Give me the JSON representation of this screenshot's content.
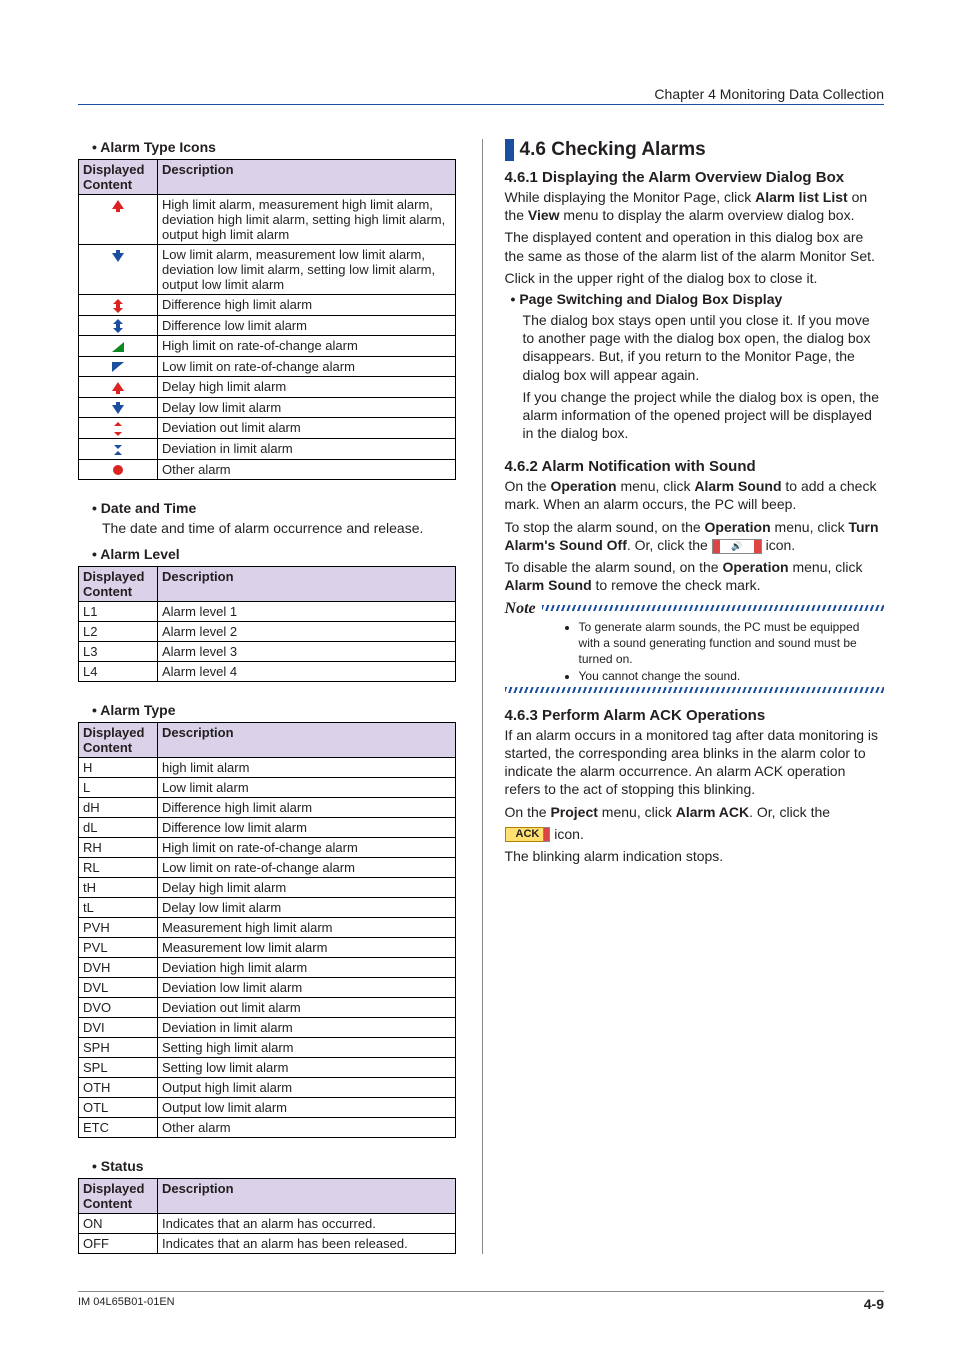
{
  "header": {
    "chapter": "Chapter 4  Monitoring Data Collection"
  },
  "footer": {
    "doc_id": "IM 04L65B01-01EN",
    "page": "4-9"
  },
  "left": {
    "s1": {
      "title": "Alarm Type Icons",
      "th1": "Displayed Content",
      "th2": "Description",
      "rows": [
        "High limit alarm, measurement high limit alarm, deviation high limit alarm, setting high limit alarm, output high limit alarm",
        "Low limit alarm, measurement low limit alarm, deviation low limit alarm, setting low limit alarm, output low limit alarm",
        "Difference high limit alarm",
        "Difference low limit alarm",
        "High limit on rate-of-change alarm",
        "Low limit on rate-of-change alarm",
        "Delay high limit alarm",
        "Delay low limit alarm",
        "Deviation out limit alarm",
        "Deviation in limit alarm",
        "Other alarm"
      ]
    },
    "s2": {
      "title": "Date and Time",
      "text": "The date and time of alarm occurrence and release."
    },
    "s3": {
      "title": "Alarm Level",
      "th1": "Displayed Content",
      "th2": "Description",
      "rows": [
        {
          "c": "L1",
          "d": "Alarm level 1"
        },
        {
          "c": "L2",
          "d": "Alarm level 2"
        },
        {
          "c": "L3",
          "d": "Alarm level 3"
        },
        {
          "c": "L4",
          "d": "Alarm level 4"
        }
      ]
    },
    "s4": {
      "title": "Alarm Type",
      "th1": "Displayed Content",
      "th2": "Description",
      "rows": [
        {
          "c": "H",
          "d": "high limit alarm"
        },
        {
          "c": "L",
          "d": "Low limit alarm"
        },
        {
          "c": "dH",
          "d": "Difference high limit alarm"
        },
        {
          "c": "dL",
          "d": "Difference low limit alarm"
        },
        {
          "c": "RH",
          "d": "High limit on rate-of-change alarm"
        },
        {
          "c": "RL",
          "d": "Low limit on rate-of-change alarm"
        },
        {
          "c": "tH",
          "d": "Delay high limit alarm"
        },
        {
          "c": "tL",
          "d": "Delay low limit alarm"
        },
        {
          "c": "PVH",
          "d": "Measurement high limit alarm"
        },
        {
          "c": "PVL",
          "d": "Measurement low limit alarm"
        },
        {
          "c": "DVH",
          "d": "Deviation high limit alarm"
        },
        {
          "c": "DVL",
          "d": "Deviation low limit alarm"
        },
        {
          "c": "DVO",
          "d": "Deviation out limit alarm"
        },
        {
          "c": "DVI",
          "d": "Deviation in limit alarm"
        },
        {
          "c": "SPH",
          "d": "Setting high limit alarm"
        },
        {
          "c": "SPL",
          "d": "Setting low limit alarm"
        },
        {
          "c": "OTH",
          "d": "Output high limit alarm"
        },
        {
          "c": "OTL",
          "d": "Output low limit alarm"
        },
        {
          "c": "ETC",
          "d": "Other alarm"
        }
      ]
    },
    "s5": {
      "title": "Status",
      "th1": "Displayed Content",
      "th2": "Description",
      "rows": [
        {
          "c": "ON",
          "d": "Indicates that an alarm has occurred."
        },
        {
          "c": "OFF",
          "d": "Indicates that an alarm has been released."
        }
      ]
    }
  },
  "right": {
    "title": "4.6   Checking Alarms",
    "s1": {
      "title": "4.6.1  Displaying the Alarm Overview Dialog Box",
      "p1a": "While displaying the Monitor Page, click ",
      "p1b": "Alarm list List",
      "p1c": " on the ",
      "p1d": "View",
      "p1e": " menu to display the alarm overview dialog box.",
      "p2": "The displayed content and operation in this dialog box are the same as those of the alarm list of the alarm Monitor Set.",
      "p3": "Click         in the upper right of the dialog box to close it.",
      "sub": "Page Switching and Dialog Box Display",
      "p4": "The dialog box stays open until you close it. If you move to another page with the dialog box open, the dialog box disappears. But, if you return to the Monitor Page, the dialog box will appear again.",
      "p5": "If you change the project while the dialog box is open, the alarm information of the opened project will be displayed in the dialog box."
    },
    "s2": {
      "title": "4.6.2  Alarm Notification with Sound",
      "p1a": "On the ",
      "p1b": "Operation",
      "p1c": " menu, click ",
      "p1d": "Alarm Sound",
      "p1e": " to add a check mark. When an alarm occurs, the PC will beep.",
      "p2a": "To stop the alarm sound, on the ",
      "p2b": "Operation",
      "p2c": " menu, click ",
      "p2d": "Turn Alarm's Sound Off",
      "p2e": ". Or, click the ",
      "p2f": " icon.",
      "p3a": "To disable the alarm sound, on the ",
      "p3b": "Operation",
      "p3c": " menu, click ",
      "p3d": "Alarm Sound",
      "p3e": " to remove the check mark.",
      "note_label": "Note",
      "note1": "To generate alarm sounds, the PC must be equipped with a sound generating function and sound must be turned on.",
      "note2": "You cannot change the sound."
    },
    "s3": {
      "title": "4.6.3  Perform Alarm ACK Operations",
      "p1": "If an alarm occurs in a monitored tag after data monitoring is started, the corresponding area blinks in the alarm color to indicate the alarm occurrence. An alarm ACK operation refers to the act of stopping this blinking.",
      "p2a": "On the ",
      "p2b": "Project",
      "p2c": "  menu, click ",
      "p2d": "Alarm ACK",
      "p2e": ". Or, click the ",
      "p2f": " icon.",
      "ack_label": "ACK",
      "p3": "The blinking alarm indication stops."
    }
  }
}
